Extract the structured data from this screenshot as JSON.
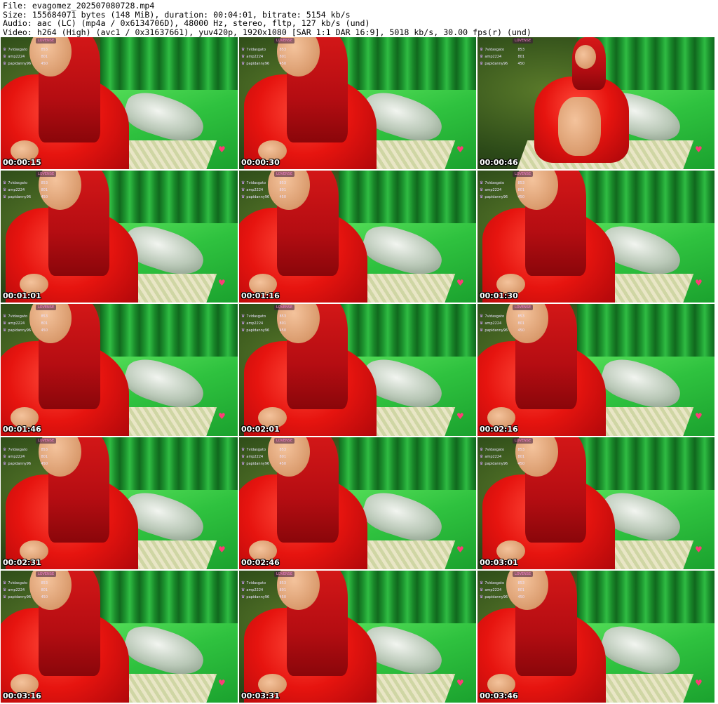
{
  "header": {
    "line1": "File: evagomez_202507080728.mp4",
    "line2": "Size: 155684071 bytes (148 MiB), duration: 00:04:01, bitrate: 5154 kb/s",
    "line3": "Audio: aac (LC) (mp4a / 0x6134706D), 48000 Hz, stereo, fltp, 127 kb/s (und)",
    "line4": "Video: h264 (High) (avc1 / 0x31637661), yuv420p, 1920x1080 [SAR 1:1 DAR 16:9], 5018 kb/s, 30.00 fps(r) (und)"
  },
  "overlay": {
    "brand": "LOVENSE",
    "rows": [
      {
        "name": "7vidasgato",
        "score": "853"
      },
      {
        "name": "amp2224",
        "score": "801"
      },
      {
        "name": "papidanny96",
        "score": "450"
      }
    ]
  },
  "colors": {
    "sheet": "#2fc23f",
    "robe": "#e6140f",
    "heart": "#ff3b77"
  },
  "frames": [
    {
      "ts": "00:00:15"
    },
    {
      "ts": "00:00:30"
    },
    {
      "ts": "00:00:46"
    },
    {
      "ts": "00:01:01"
    },
    {
      "ts": "00:01:16"
    },
    {
      "ts": "00:01:30"
    },
    {
      "ts": "00:01:46"
    },
    {
      "ts": "00:02:01"
    },
    {
      "ts": "00:02:16"
    },
    {
      "ts": "00:02:31"
    },
    {
      "ts": "00:02:46"
    },
    {
      "ts": "00:03:01"
    },
    {
      "ts": "00:03:16"
    },
    {
      "ts": "00:03:31"
    },
    {
      "ts": "00:03:46"
    }
  ]
}
